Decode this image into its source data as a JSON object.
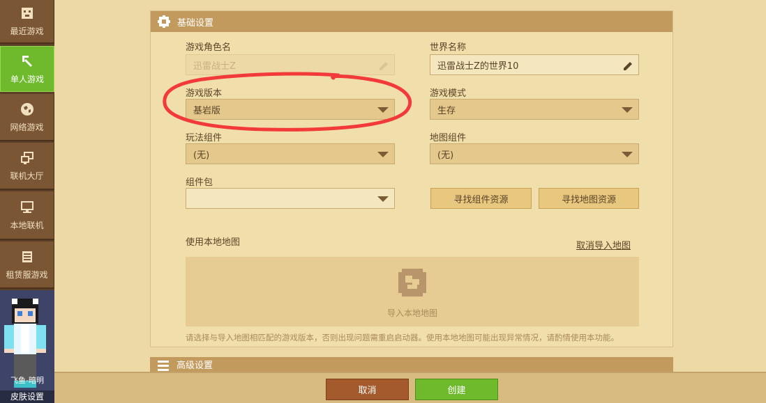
{
  "sidebar": {
    "items": [
      {
        "label": "最近游戏",
        "icon": "gamepad-icon"
      },
      {
        "label": "单人游戏",
        "icon": "pickaxe-icon",
        "active": true
      },
      {
        "label": "网络游戏",
        "icon": "globe-icon"
      },
      {
        "label": "联机大厅",
        "icon": "network-icon"
      },
      {
        "label": "本地联机",
        "icon": "monitor-icon"
      },
      {
        "label": "租赁服游戏",
        "icon": "server-icon"
      }
    ],
    "skin": {
      "player_name": "飞鱼-暗明",
      "label": "皮肤设置"
    }
  },
  "basic_settings": {
    "title": "基础设置",
    "role_name": {
      "label": "游戏角色名",
      "value": "迅雷战士Z"
    },
    "world_name": {
      "label": "世界名称",
      "value": "迅雷战士Z的世界10"
    },
    "game_version": {
      "label": "游戏版本",
      "value": "基岩版"
    },
    "game_mode": {
      "label": "游戏模式",
      "value": "生存"
    },
    "gameplay_addon": {
      "label": "玩法组件",
      "value": "(无)"
    },
    "map_addon": {
      "label": "地图组件",
      "value": "(无)"
    },
    "addon_pack": {
      "label": "组件包",
      "value": ""
    },
    "find_addon_btn": "寻找组件资源",
    "find_map_btn": "寻找地图资源",
    "local_map": {
      "label": "使用本地地图",
      "cancel_link": "取消导入地图",
      "import_text": "导入本地地图",
      "note": "请选择与导入地图相匹配的游戏版本，否则出现问题需重启启动器。使用本地地图可能出现异常情况，请酌情使用本功能。"
    }
  },
  "advanced_settings": {
    "title": "高级设置"
  },
  "footer": {
    "cancel": "取消",
    "create": "创建"
  },
  "colors": {
    "accent_green": "#6fba2c",
    "cancel_brown": "#a45a2c",
    "header_tan": "#c29a5d",
    "annotation_red": "#f23a3a"
  }
}
